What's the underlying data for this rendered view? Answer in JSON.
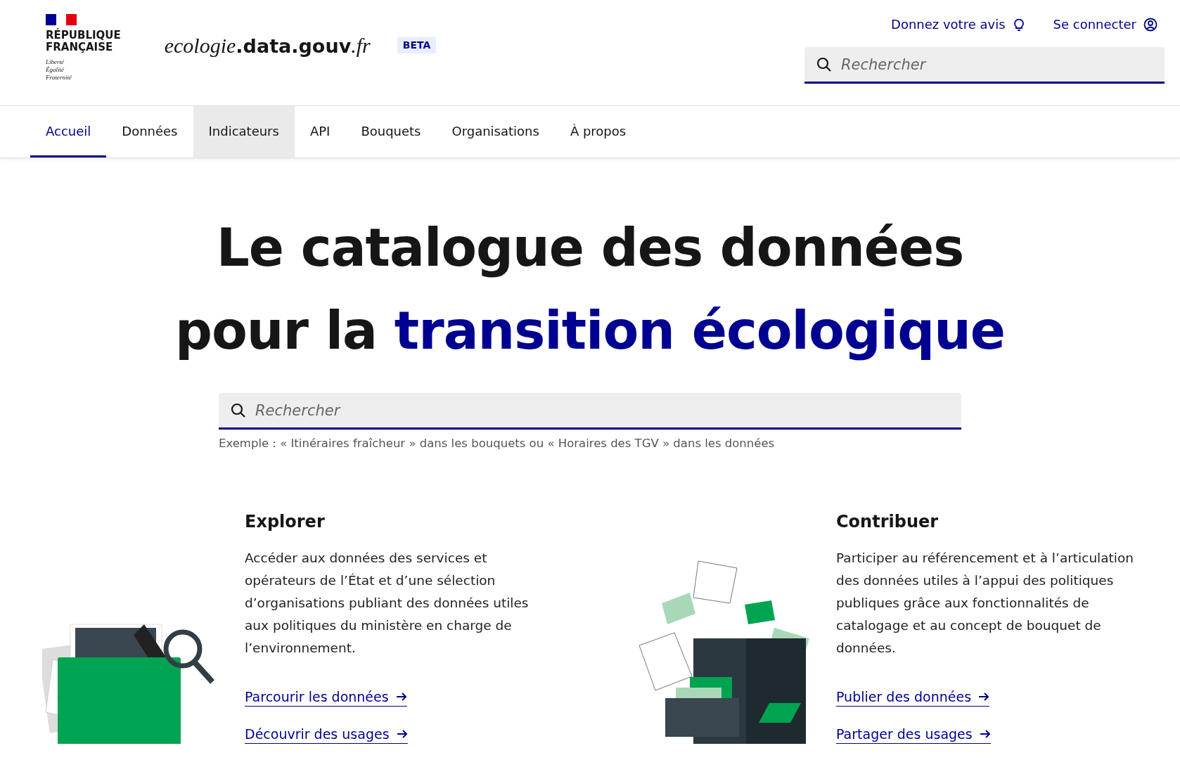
{
  "header": {
    "republic": [
      "RÉPUBLIQUE",
      "FRANÇAISE"
    ],
    "motto": [
      "Liberté",
      "Égalité",
      "Fraternité"
    ],
    "site_name": {
      "prefix": "ecologie",
      "middle": ".data.gouv",
      "suffix": ".fr"
    },
    "badge": "BETA",
    "quick_links": [
      {
        "label": "Donnez votre avis",
        "kind": "feedback"
      },
      {
        "label": "Se connecter",
        "kind": "account"
      }
    ],
    "search": {
      "placeholder": "Rechercher"
    }
  },
  "nav": [
    {
      "label": "Accueil",
      "selected": true,
      "hovered": false
    },
    {
      "label": "Données",
      "selected": false,
      "hovered": false
    },
    {
      "label": "Indicateurs",
      "selected": false,
      "hovered": true
    },
    {
      "label": "API",
      "selected": false,
      "hovered": false
    },
    {
      "label": "Bouquets",
      "selected": false,
      "hovered": false
    },
    {
      "label": "Organisations",
      "selected": false,
      "hovered": false
    },
    {
      "label": "À propos",
      "selected": false,
      "hovered": false
    }
  ],
  "hero": {
    "title_line_1": "Le catalogue des données",
    "title_line_2_plain": "pour la",
    "title_line_2_accent": "transition écologique",
    "search": {
      "placeholder": "Rechercher"
    },
    "hint": "Exemple : « Itinéraires fraîcheur » dans les bouquets ou « Horaires des TGV » dans les données"
  },
  "sections": [
    {
      "kind": "folder",
      "title": "Explorer",
      "text": "Accéder aux données des services et opérateurs de l’État et d’une sélection d’organisations publiant des données utiles aux politiques du ministère en charge de l’environnement.",
      "links": [
        "Parcourir les données",
        "Découvrir des usages"
      ]
    },
    {
      "kind": "cabinet",
      "title": "Contribuer",
      "text": "Participer au référencement et à l’articulation des données utiles à l’appui des politiques publiques grâce aux fonctionnalités de catalogage et au concept de bouquet de données.",
      "links": [
        "Publier des données",
        "Partager des usages"
      ]
    }
  ]
}
